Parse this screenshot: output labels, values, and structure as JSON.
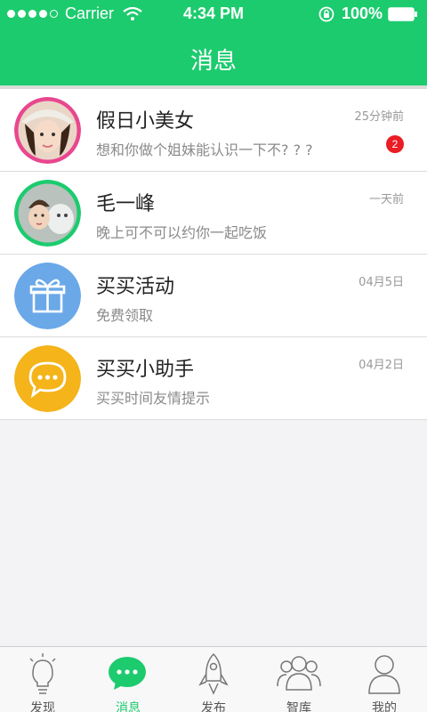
{
  "status_bar": {
    "carrier": "Carrier",
    "time": "4:34 PM",
    "battery": "100%"
  },
  "nav": {
    "title": "消息"
  },
  "messages": [
    {
      "name": "假日小美女",
      "preview": "想和你做个姐妹能认识一下不? ? ?",
      "time": "25分钟前",
      "unread": "2",
      "avatar": "girl-avatar",
      "ring_color": "#e8478f"
    },
    {
      "name": "毛一峰",
      "preview": "晚上可不可以约你一起吃饭",
      "time": "一天前",
      "avatar": "boy-avatar",
      "ring_color": "#1ccb6e"
    },
    {
      "name": "买买活动",
      "preview": "免费领取",
      "time": "04月5日",
      "avatar": "gift-icon",
      "ring_color": "#6aa8e8"
    },
    {
      "name": "买买小助手",
      "preview": "买买时间友情提示",
      "time": "04月2日",
      "avatar": "chat-bubble-icon",
      "ring_color": "#f4b41a"
    }
  ],
  "tabs": [
    {
      "label": "发现",
      "icon": "lightbulb-icon"
    },
    {
      "label": "消息",
      "icon": "message-icon",
      "active": true
    },
    {
      "label": "发布",
      "icon": "rocket-icon"
    },
    {
      "label": "智库",
      "icon": "group-icon"
    },
    {
      "label": "我的",
      "icon": "person-icon"
    }
  ],
  "colors": {
    "brand": "#1ccb6e",
    "badge": "#ea1c24"
  }
}
